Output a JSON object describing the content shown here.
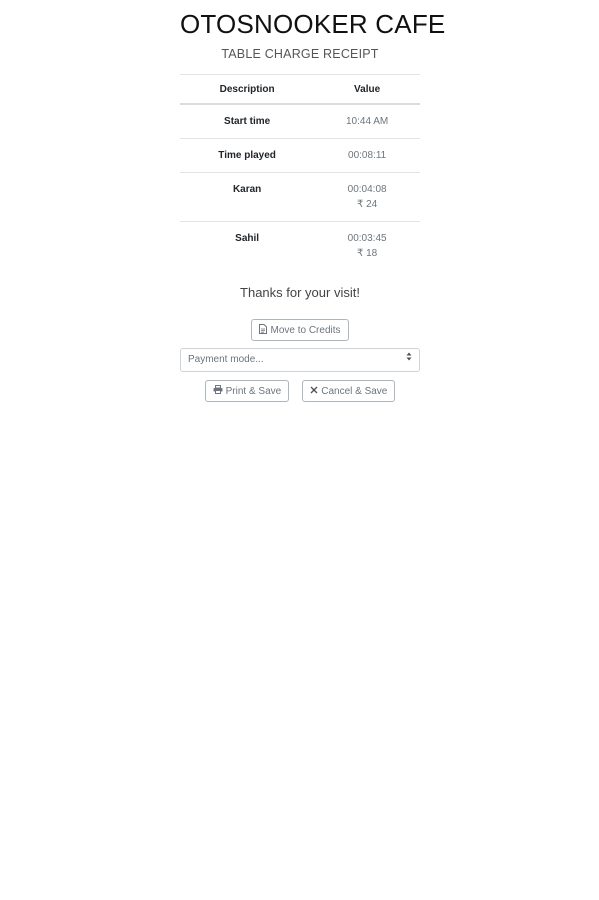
{
  "receipt": {
    "title": "OTOSNOOKER CAFE",
    "subtitle": "TABLE CHARGE RECEIPT",
    "table": {
      "headers": [
        "Description",
        "Value"
      ],
      "rows": [
        {
          "label": "Start time",
          "value": "10:44 AM",
          "extra": ""
        },
        {
          "label": "Time played",
          "value": "00:08:11",
          "extra": ""
        },
        {
          "label": "Karan",
          "value": "00:04:08",
          "extra": "₹ 24"
        },
        {
          "label": "Sahil",
          "value": "00:03:45",
          "extra": "₹ 18"
        }
      ]
    },
    "thanks": "Thanks for your visit!",
    "buttons": {
      "move_to_credits": "Move to Credits",
      "print_save": "Print & Save",
      "cancel_save": "Cancel & Save"
    },
    "payment_select": {
      "placeholder": "Payment mode..."
    },
    "icons": {
      "credits": "file-icon",
      "print": "printer-icon",
      "cancel": "close-icon",
      "select_caret": "sort-caret-icon"
    }
  }
}
